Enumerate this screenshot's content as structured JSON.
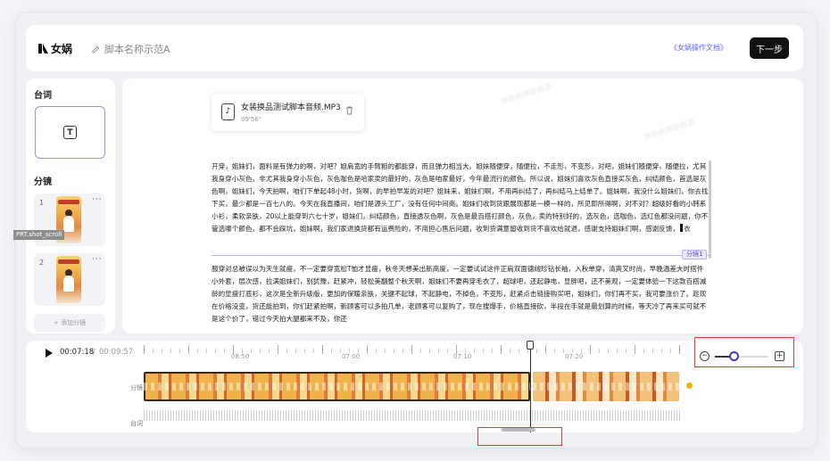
{
  "header": {
    "logo_text": "女娲",
    "script_name_placeholder": "脚本名称示范A",
    "doc_link": "《女娲操作文档》",
    "next_label": "下一步"
  },
  "left": {
    "lines_title": "台词",
    "lines_card_icon": "T",
    "shots_title": "分镜",
    "shots": [
      {
        "num": "1",
        "more": "···"
      },
      {
        "num": "2",
        "more": "···"
      }
    ],
    "add_shot": "+ 添加分镜",
    "float_label": "PRT.shot_scroll"
  },
  "audio": {
    "filename": "女装换品测试脚本音频.MP3",
    "duration": "09'56\""
  },
  "script": {
    "segment1": "开穿，姐妹们，面料是有弹力的啊，对吧？姐肩宽的手臂粗的都能穿，而且弹力相当大。姐妹随便穿，随便拉，不走形，不变形，对吧，姐妹们随便穿，随便拉，尤其我身穿小灰色，非尤其我身穿小灰色，灰色咖色是哈家卖的最好的，灰色是咱家最好，今年最流行的颜色。所以说，姐妹们喜欢灰色直接买灰色，纠结颜色，首选是灰色啊，姐妹们，今天拍啊，咱们下单起48小时，货啊，的早拍早发的对吧？姐妹来，姐妹们啊，不用再纠结了，再纠结马上结单了。姐妹啊，我没什么姐妹们，你去找下买，最少都是一百七八的。今天在我直播间，咱们是源头工厂，没有任何中间商。姐妹们收到货跟展现都是一模一样的，所见即所得啊，对不对？超级好看的小韩系小衫，柔软亲肤，20以上能穿到六七十岁，姐妹们，纠结颜色，直接透灰色啊，灰色是最百搭打颜色，灰色，卖的特别好的，选灰色，选咖色，选红色都没问题，你不管选哪个颜色，都不会踩坑，姐妹啊，我们家退换货都有运费险的，不用担心售后问题，收到货满意留收到货不喜欢给就退，感谢支持姐妹们啊，感谢反馈，",
    "segment1_tail": "衣",
    "segment2": "服穿对总被误以为天生就瘦，不一定要穿宽松T恤才显瘦，秋冬天想美出新高度，一定要试试这件正肩双面德绒珍钻长袖，入秋单穿，清爽又时尚，早晚温差大时搭件小外套，层次感，拉满姐妹们，别犹豫，赶紧冲，轻松美翻整个秋天啊，姐妹们不要再穿毛衣了，超球吧，还起静电，显胖吧，还不美观，一定要体验一下这款百搭减龄的显瘦打底衫，这次是全新升级版，更加的保暖亲肤，关键不起球，不起静电，不掉色，不变形，赶紧点击链接购买吧，姐妹们，你们再不买，我可要涨价了。趁现在价格没变，货还能拍到，你们赶紧拍啊，新顾客可以多拍几单，老顾客可以复购了，现在搜爆手，价格直接砍，半段在手就是最划算的时候，等天冷了再来买可就不是这个价了，错过今天拍大腿都来不及，你还",
    "segment_tag": "分镜1"
  },
  "timeline": {
    "current_time": "00:07:18",
    "separator": "/",
    "total_time": "00:09:57",
    "ticks": [
      "08:50",
      "07:00",
      "07:10",
      "07:20"
    ],
    "video_row_label": "分镜",
    "audio_row_label": "台词"
  },
  "zoom": {
    "minus": "−",
    "plus": "+",
    "level": 0.35
  },
  "colors": {
    "accent": "#5b6bff",
    "next_button": "#111111",
    "highlight_box": "#e53935",
    "selected_card": "#9b8cf2",
    "dot": "#f4b400"
  }
}
